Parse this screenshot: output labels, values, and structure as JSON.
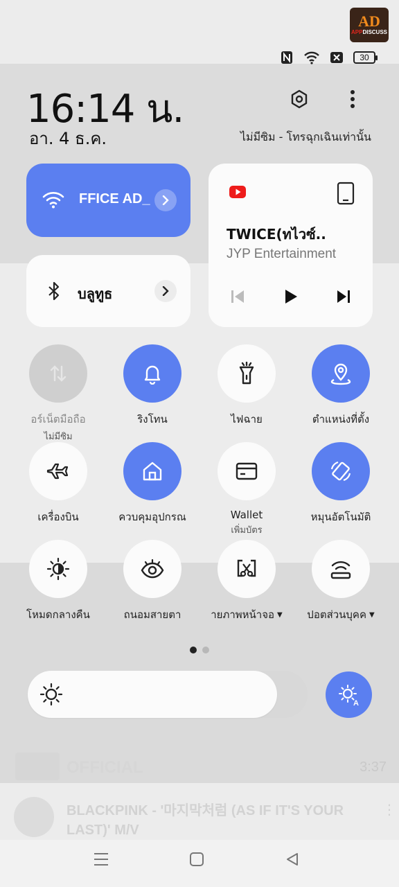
{
  "background_app": {
    "video_duration": "3:37",
    "channel_badge": "OFFICIAL",
    "next_video_title": "BLACKPINK - '마지막처럼 (AS IF IT'S YOUR LAST)' M/V"
  },
  "watermark": {
    "big": "AD",
    "small_app": "APP",
    "small_rest": "DISCUSS"
  },
  "status_bar": {
    "icons": [
      "nfc-icon",
      "wifi-icon",
      "no-sim-icon",
      "battery-icon"
    ],
    "battery_level": "30"
  },
  "header": {
    "time": "16:14 น.",
    "date": "อา. 4 ธ.ค.",
    "sim_status": "ไม่มีซิม - โทรฉุกเฉินเท่านั้น",
    "settings_icon": "settings-icon",
    "more_icon": "more-vertical-icon"
  },
  "wifi_tile": {
    "network": "FFICE AD_",
    "icon": "wifi-icon",
    "active": true
  },
  "bluetooth_tile": {
    "label": "บลูทูธ",
    "icon": "bluetooth-icon",
    "active": false
  },
  "media": {
    "app_icon": "youtube-icon",
    "device_icon": "phone-icon",
    "title": "TWICE(ทไวซ์..",
    "artist": "JYP Entertainment"
  },
  "toggles": [
    {
      "label": "อร์เน็ตมือถือ",
      "sub": "ไม่มีซิม",
      "icon": "mobile-data-icon",
      "state": "disabled"
    },
    {
      "label": "ริงโทน",
      "sub": "",
      "icon": "bell-icon",
      "state": "on"
    },
    {
      "label": "ไฟฉาย",
      "sub": "",
      "icon": "flashlight-icon",
      "state": "off"
    },
    {
      "label": "ตำแหน่งที่ตั้ง",
      "sub": "",
      "icon": "location-icon",
      "state": "on"
    },
    {
      "label": "เครื่องบิน",
      "sub": "",
      "icon": "airplane-icon",
      "state": "off"
    },
    {
      "label": "ควบคุมอุปกรณ",
      "sub": "",
      "icon": "home-icon",
      "state": "on"
    },
    {
      "label": "Wallet",
      "sub": "เพิ่มบัตร",
      "icon": "wallet-icon",
      "state": "off"
    },
    {
      "label": "หมุนอัตโนมัติ",
      "sub": "",
      "icon": "auto-rotate-icon",
      "state": "on"
    },
    {
      "label": "โหมดกลางคืน",
      "sub": "",
      "icon": "dark-mode-icon",
      "state": "off"
    },
    {
      "label": "ถนอมสายตา",
      "sub": "",
      "icon": "eye-icon",
      "state": "off"
    },
    {
      "label": "ายภาพหน้าจอ",
      "sub": "",
      "icon": "screenshot-icon",
      "state": "off",
      "dropdown": true
    },
    {
      "label": "ปอตส่วนบุคค",
      "sub": "",
      "icon": "hotspot-icon",
      "state": "off",
      "dropdown": true
    }
  ],
  "pager": {
    "pages": 2,
    "current": 1
  },
  "brightness": {
    "level": 0.89,
    "auto_icon": "auto-brightness-icon"
  },
  "nav_bar": {
    "buttons": [
      "recents-icon",
      "home-icon",
      "back-icon"
    ]
  }
}
